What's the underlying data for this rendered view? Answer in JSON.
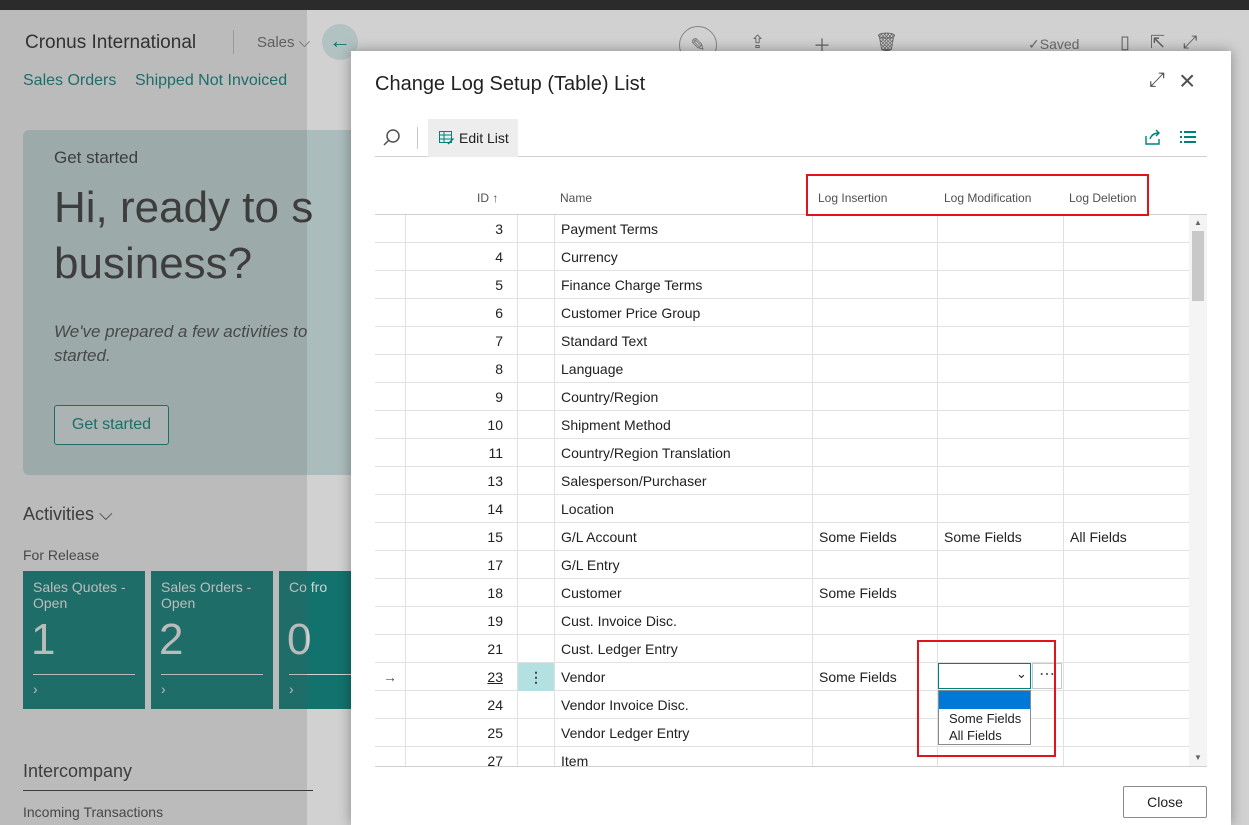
{
  "background": {
    "company": "Cronus International",
    "menu": "Sales",
    "nav_links": [
      "Sales Orders",
      "Shipped Not Invoiced"
    ],
    "saved_label": "Saved",
    "hero": {
      "small": "Get started",
      "big_line1": "Hi, ready to s",
      "big_line2": "business?",
      "italic_line1": "We've prepared a few activities to",
      "italic_line2": "started.",
      "button": "Get started"
    },
    "activities_title": "Activities",
    "for_release": "For Release",
    "tiles": [
      {
        "title": "Sales Quotes - Open",
        "value": "1"
      },
      {
        "title": "Sales Orders - Open",
        "value": "2"
      },
      {
        "title": "Co fro",
        "value": "0"
      }
    ],
    "intercompany_title": "Intercompany",
    "incoming": "Incoming Transactions"
  },
  "dialog": {
    "title": "Change Log Setup (Table) List",
    "edit_list": "Edit List",
    "columns": {
      "id": "ID ↑",
      "name": "Name",
      "log_insertion": "Log Insertion",
      "log_modification": "Log Modification",
      "log_deletion": "Log Deletion"
    },
    "rows": [
      {
        "id": "3",
        "name": "Payment Terms",
        "ins": "",
        "mod": "",
        "del": ""
      },
      {
        "id": "4",
        "name": "Currency",
        "ins": "",
        "mod": "",
        "del": ""
      },
      {
        "id": "5",
        "name": "Finance Charge Terms",
        "ins": "",
        "mod": "",
        "del": ""
      },
      {
        "id": "6",
        "name": "Customer Price Group",
        "ins": "",
        "mod": "",
        "del": ""
      },
      {
        "id": "7",
        "name": "Standard Text",
        "ins": "",
        "mod": "",
        "del": ""
      },
      {
        "id": "8",
        "name": "Language",
        "ins": "",
        "mod": "",
        "del": ""
      },
      {
        "id": "9",
        "name": "Country/Region",
        "ins": "",
        "mod": "",
        "del": ""
      },
      {
        "id": "10",
        "name": "Shipment Method",
        "ins": "",
        "mod": "",
        "del": ""
      },
      {
        "id": "11",
        "name": "Country/Region Translation",
        "ins": "",
        "mod": "",
        "del": ""
      },
      {
        "id": "13",
        "name": "Salesperson/Purchaser",
        "ins": "",
        "mod": "",
        "del": ""
      },
      {
        "id": "14",
        "name": "Location",
        "ins": "",
        "mod": "",
        "del": ""
      },
      {
        "id": "15",
        "name": "G/L Account",
        "ins": "Some Fields",
        "mod": "Some Fields",
        "del": "All Fields"
      },
      {
        "id": "17",
        "name": "G/L Entry",
        "ins": "",
        "mod": "",
        "del": ""
      },
      {
        "id": "18",
        "name": "Customer",
        "ins": "Some Fields",
        "mod": "",
        "del": ""
      },
      {
        "id": "19",
        "name": "Cust. Invoice Disc.",
        "ins": "",
        "mod": "",
        "del": ""
      },
      {
        "id": "21",
        "name": "Cust. Ledger Entry",
        "ins": "",
        "mod": "",
        "del": ""
      },
      {
        "id": "23",
        "name": "Vendor",
        "ins": "Some Fields",
        "mod": "",
        "del": "",
        "selected": true
      },
      {
        "id": "24",
        "name": "Vendor Invoice Disc.",
        "ins": "",
        "mod": "",
        "del": ""
      },
      {
        "id": "25",
        "name": "Vendor Ledger Entry",
        "ins": "",
        "mod": "",
        "del": ""
      },
      {
        "id": "27",
        "name": "Item",
        "ins": "",
        "mod": "",
        "del": ""
      }
    ],
    "dropdown": {
      "options": [
        "",
        "Some Fields",
        "All Fields"
      ],
      "selected_index": 0
    },
    "close": "Close"
  },
  "colors": {
    "accent": "#00807a",
    "highlight_box": "#e2131b",
    "selected_option": "#0078d7"
  }
}
